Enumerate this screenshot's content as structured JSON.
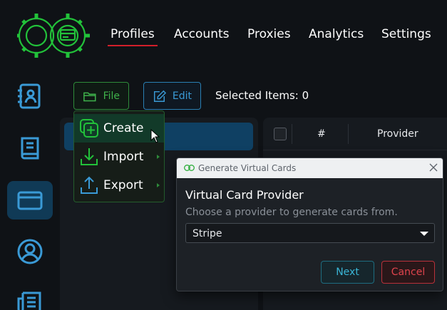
{
  "nav": {
    "items": [
      "Profiles",
      "Accounts",
      "Proxies",
      "Analytics",
      "Settings"
    ],
    "active": "Profiles"
  },
  "sidebar": {
    "items": [
      {
        "icon": "contacts-book-icon"
      },
      {
        "icon": "book-icon"
      },
      {
        "icon": "credit-card-icon"
      },
      {
        "icon": "user-circle-icon"
      },
      {
        "icon": "newspaper-icon"
      }
    ]
  },
  "toolbar": {
    "file_label": "File",
    "edit_label": "Edit",
    "selected_items": "Selected Items: 0"
  },
  "file_menu": {
    "items": [
      {
        "label": "Create",
        "icon": "create-plus-icon"
      },
      {
        "label": "Import",
        "icon": "import-icon"
      },
      {
        "label": "Export",
        "icon": "export-icon"
      }
    ]
  },
  "table": {
    "headers": [
      "#",
      "Provider"
    ]
  },
  "dialog": {
    "title": "Generate Virtual Cards",
    "heading": "Virtual Card Provider",
    "subtitle": "Choose a provider to generate cards from.",
    "provider_value": "Stripe",
    "next_label": "Next",
    "cancel_label": "Cancel"
  },
  "colors": {
    "background": "#0f1216",
    "green": "#3fb24b",
    "blue": "#3a9ad6",
    "red": "#d21f2a",
    "teal": "#3ab6d6"
  }
}
